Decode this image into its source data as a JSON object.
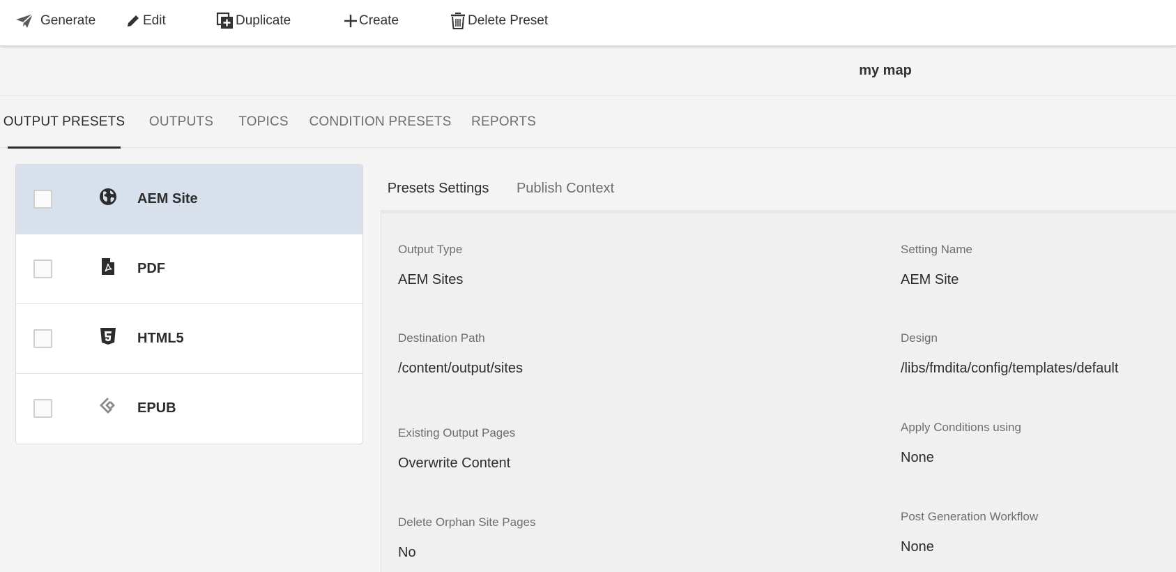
{
  "toolbar": {
    "generate": {
      "label": "Generate",
      "icon": "send-icon"
    },
    "edit": {
      "label": "Edit",
      "icon": "pencil-icon"
    },
    "duplicate": {
      "label": "Duplicate",
      "icon": "duplicate-icon"
    },
    "create": {
      "label": "Create",
      "icon": "plus-icon"
    },
    "delete_preset": {
      "label": "Delete Preset",
      "icon": "trash-icon"
    }
  },
  "header": {
    "title": "my map"
  },
  "main_tabs": [
    {
      "label": "OUTPUT PRESETS",
      "active": true
    },
    {
      "label": "OUTPUTS",
      "active": false
    },
    {
      "label": "TOPICS",
      "active": false
    },
    {
      "label": "CONDITION PRESETS",
      "active": false
    },
    {
      "label": "REPORTS",
      "active": false
    }
  ],
  "presets": [
    {
      "label": "AEM Site",
      "icon": "globe-icon",
      "selected": true
    },
    {
      "label": "PDF",
      "icon": "pdf-file-icon",
      "selected": false
    },
    {
      "label": "HTML5",
      "icon": "html5-icon",
      "selected": false
    },
    {
      "label": "EPUB",
      "icon": "epub-icon",
      "selected": false
    }
  ],
  "detail": {
    "tabs": [
      {
        "label": "Presets Settings",
        "active": true
      },
      {
        "label": "Publish Context",
        "active": false
      }
    ],
    "fields": {
      "output_type": {
        "label": "Output Type",
        "value": "AEM Sites"
      },
      "setting_name": {
        "label": "Setting Name",
        "value": "AEM Site"
      },
      "destination_path": {
        "label": "Destination Path",
        "value": "/content/output/sites"
      },
      "design": {
        "label": "Design",
        "value": "/libs/fmdita/config/templates/default"
      },
      "existing_output_pages": {
        "label": "Existing Output Pages",
        "value": "Overwrite Content"
      },
      "apply_conditions": {
        "label": "Apply Conditions using",
        "value": "None"
      },
      "delete_orphan": {
        "label": "Delete Orphan Site Pages",
        "value": "No"
      },
      "post_generation_workflow": {
        "label": "Post Generation Workflow",
        "value": "None"
      }
    }
  },
  "colors": {
    "selected_row": "#d8e0ec",
    "text_primary": "#2c2c2c",
    "text_secondary": "#6e6e6e",
    "panel_bg": "#f0f0f0"
  }
}
